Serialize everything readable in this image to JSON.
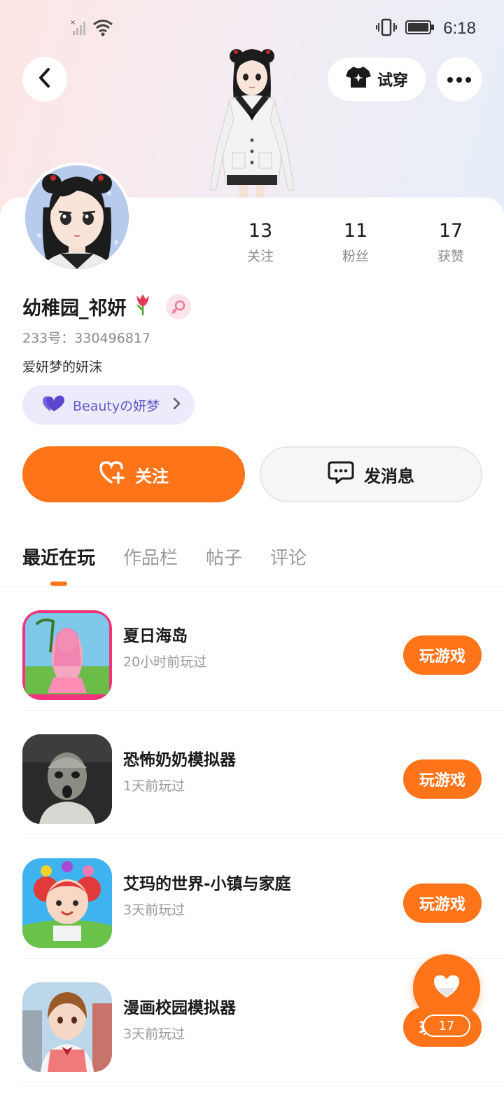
{
  "status_bar": {
    "time": "6:18"
  },
  "header": {
    "try_on_label": "试穿"
  },
  "profile": {
    "nickname": "幼稚园_祁妍",
    "uid_text": "233号：330496817",
    "bio": "爱妍梦的妍沫",
    "group_label": "Beautyの妍梦",
    "stats": [
      {
        "value": "13",
        "label": "关注"
      },
      {
        "value": "11",
        "label": "粉丝"
      },
      {
        "value": "17",
        "label": "获赞"
      }
    ]
  },
  "actions": {
    "follow_label": "关注",
    "message_label": "发消息"
  },
  "tabs": [
    "最近在玩",
    "作品栏",
    "帖子",
    "评论"
  ],
  "games": [
    {
      "name": "夏日海岛",
      "time": "20小时前玩过",
      "button": "玩游戏"
    },
    {
      "name": "恐怖奶奶模拟器",
      "time": "1天前玩过",
      "button": "玩游戏"
    },
    {
      "name": "艾玛的世界-小镇与家庭",
      "time": "3天前玩过",
      "button": "玩游戏"
    },
    {
      "name": "漫画校园模拟器",
      "time": "3天前玩过",
      "button": "玩游戏"
    }
  ],
  "like_fab": {
    "count": "17"
  },
  "colors": {
    "accent": "#ff7418",
    "group_pill": "#ecebfb",
    "group_text": "#6457c8"
  }
}
